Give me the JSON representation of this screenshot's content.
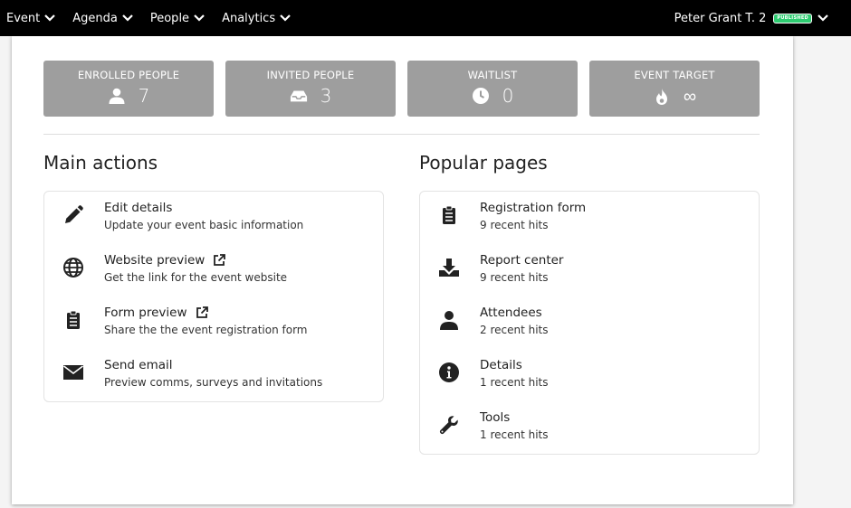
{
  "nav": {
    "items": [
      {
        "label": "Event"
      },
      {
        "label": "Agenda"
      },
      {
        "label": "People"
      },
      {
        "label": "Analytics"
      }
    ],
    "user": "Peter Grant T. 2",
    "status_badge": "PUBLISHED"
  },
  "stats": [
    {
      "label": "ENROLLED PEOPLE",
      "value": "7",
      "icon": "user-icon"
    },
    {
      "label": "INVITED PEOPLE",
      "value": "3",
      "icon": "inbox-icon"
    },
    {
      "label": "WAITLIST",
      "value": "0",
      "icon": "clock-icon"
    },
    {
      "label": "EVENT TARGET",
      "value": "∞",
      "icon": "fire-icon"
    }
  ],
  "main_actions": {
    "title": "Main actions",
    "items": [
      {
        "title": "Edit details",
        "subtitle": "Update your event basic information",
        "icon": "pencil-icon"
      },
      {
        "title": "Website preview",
        "subtitle": "Get the link for the event website",
        "icon": "globe-icon",
        "external": true
      },
      {
        "title": "Form preview",
        "subtitle": "Share the the event registration form",
        "icon": "clipboard-icon",
        "external": true
      },
      {
        "title": "Send email",
        "subtitle": "Preview comms, surveys and invitations",
        "icon": "envelope-icon"
      }
    ]
  },
  "popular_pages": {
    "title": "Popular pages",
    "items": [
      {
        "title": "Registration form",
        "subtitle": "9 recent hits",
        "icon": "clipboard-list-icon"
      },
      {
        "title": "Report center",
        "subtitle": "9 recent hits",
        "icon": "download-icon"
      },
      {
        "title": "Attendees",
        "subtitle": "2 recent hits",
        "icon": "user-icon"
      },
      {
        "title": "Details",
        "subtitle": "1 recent hits",
        "icon": "info-circle-icon"
      },
      {
        "title": "Tools",
        "subtitle": "1 recent hits",
        "icon": "wrench-icon"
      }
    ]
  },
  "colors": {
    "topbar": "#000000",
    "stat_card": "#9e9e9e",
    "badge": "#2ecc71"
  }
}
